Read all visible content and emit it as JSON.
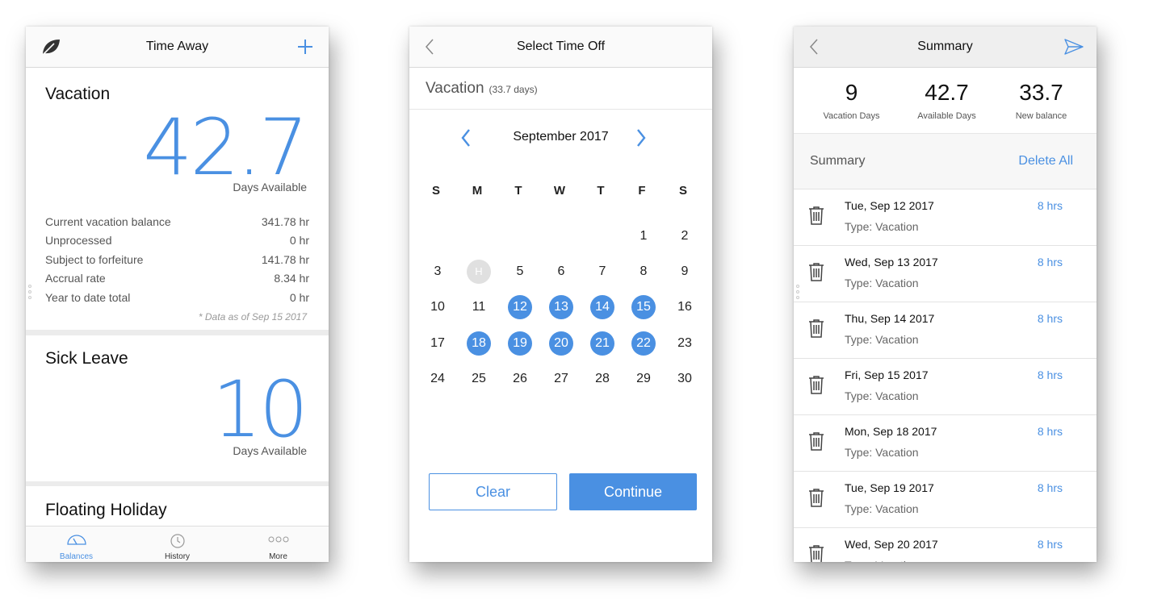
{
  "balances": {
    "title": "Time Away",
    "vacation": {
      "title": "Vacation",
      "days": "42.7",
      "days_label": "Days Available",
      "rows": [
        {
          "label": "Current vacation balance",
          "value": "341.78 hr"
        },
        {
          "label": "Unprocessed",
          "value": "0 hr"
        },
        {
          "label": "Subject to forfeiture",
          "value": "141.78 hr"
        },
        {
          "label": "Accrual rate",
          "value": "8.34 hr"
        },
        {
          "label": "Year to date total",
          "value": "0 hr"
        }
      ],
      "note": "* Data as of Sep 15 2017"
    },
    "sick": {
      "title": "Sick Leave",
      "days": "10",
      "days_label": "Days Available"
    },
    "floating": {
      "title": "Floating Holiday"
    },
    "tabs": [
      {
        "label": "Balances",
        "icon": "gauge-icon"
      },
      {
        "label": "History",
        "icon": "history-icon"
      },
      {
        "label": "More",
        "icon": "more-icon"
      }
    ]
  },
  "select": {
    "title": "Select Time Off",
    "type": "Vacation",
    "type_days": "(33.7 days)",
    "month": "September 2017",
    "weekdays": [
      "S",
      "M",
      "T",
      "W",
      "T",
      "F",
      "S"
    ],
    "weeks": [
      [
        "",
        "",
        "",
        "",
        "",
        "1",
        "2"
      ],
      [
        "3",
        "H",
        "5",
        "6",
        "7",
        "8",
        "9"
      ],
      [
        "10",
        "11",
        "12",
        "13",
        "14",
        "15",
        "16"
      ],
      [
        "17",
        "18",
        "19",
        "20",
        "21",
        "22",
        "23"
      ],
      [
        "24",
        "25",
        "26",
        "27",
        "28",
        "29",
        "30"
      ]
    ],
    "selected_days": [
      "12",
      "13",
      "14",
      "15",
      "18",
      "19",
      "20",
      "21",
      "22"
    ],
    "holiday_marker": "H",
    "clear_label": "Clear",
    "continue_label": "Continue"
  },
  "summary": {
    "title": "Summary",
    "stats": [
      {
        "value": "9",
        "label": "Vacation Days"
      },
      {
        "value": "42.7",
        "label": "Available Days"
      },
      {
        "value": "33.7",
        "label": "New balance"
      }
    ],
    "section_label": "Summary",
    "delete_all_label": "Delete All",
    "items": [
      {
        "date": "Tue, Sep 12 2017",
        "type": "Type: Vacation",
        "hours": "8 hrs"
      },
      {
        "date": "Wed, Sep 13 2017",
        "type": "Type: Vacation",
        "hours": "8 hrs"
      },
      {
        "date": "Thu, Sep 14 2017",
        "type": "Type: Vacation",
        "hours": "8 hrs"
      },
      {
        "date": "Fri, Sep 15 2017",
        "type": "Type: Vacation",
        "hours": "8 hrs"
      },
      {
        "date": "Mon, Sep 18 2017",
        "type": "Type: Vacation",
        "hours": "8 hrs"
      },
      {
        "date": "Tue, Sep 19 2017",
        "type": "Type: Vacation",
        "hours": "8 hrs"
      },
      {
        "date": "Wed, Sep 20 2017",
        "type": "Type: Vacation",
        "hours": "8 hrs"
      }
    ]
  },
  "colors": {
    "accent": "#4a90e2",
    "selected_day_bg": "#4a90e2",
    "holiday_bg": "#e0e0e0"
  }
}
